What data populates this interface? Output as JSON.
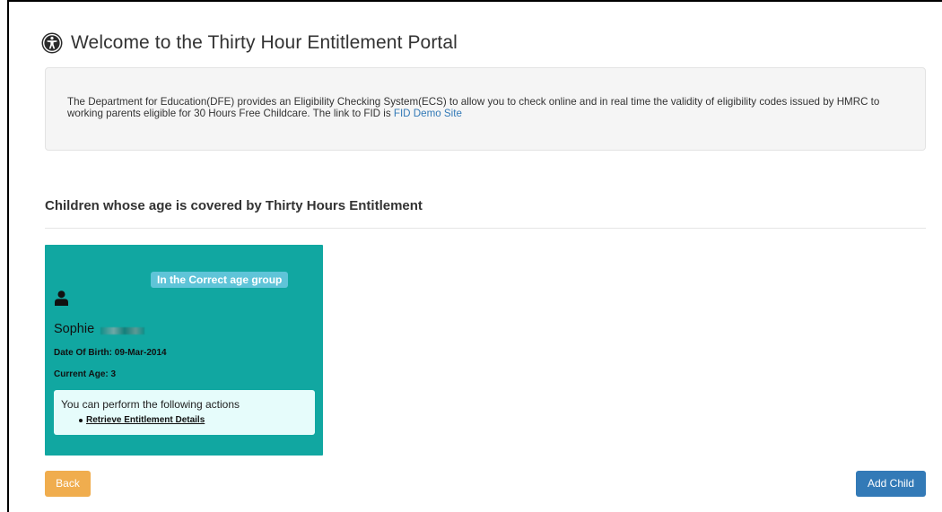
{
  "header": {
    "title": "Welcome to the Thirty Hour Entitlement Portal",
    "icon": "accessibility-icon"
  },
  "info": {
    "text": "The Department for Education(DFE) provides an Eligibility Checking System(ECS) to allow you to check online and in real time the validity of eligibility codes issued by HMRC to working parents eligible for 30 Hours Free Childcare. The link to FID is",
    "link_label": "FID Demo Site"
  },
  "section": {
    "heading": "Children whose age is covered by Thirty Hours Entitlement"
  },
  "child_card": {
    "badge": "In the Correct age group",
    "name": "Sophie",
    "dob": "Date Of Birth: 09-Mar-2014",
    "age": "Current Age: 3",
    "actions_caption": "You can perform the following actions",
    "actions": [
      {
        "label": "Retrieve Entitlement Details"
      }
    ],
    "colors": {
      "card_bg": "#11a7a1",
      "badge_bg": "#5fc4d8",
      "actions_bg": "#e6fcfb"
    }
  },
  "footer": {
    "back_label": "Back",
    "add_child_label": "Add Child",
    "colors": {
      "back": "#f0ad4e",
      "add_child": "#337ab7"
    }
  }
}
